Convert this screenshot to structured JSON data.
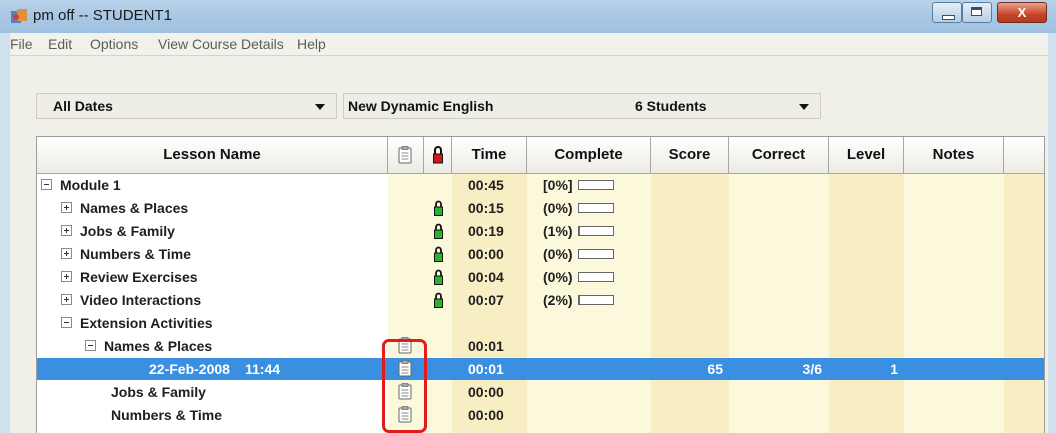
{
  "window": {
    "title": "pm off -- STUDENT1",
    "close_glyph": "X"
  },
  "menu": [
    "File",
    "Edit",
    "Options",
    "View Course Details",
    "Help"
  ],
  "filters": {
    "dates": "All Dates",
    "course": "New Dynamic English",
    "students": "6 Students"
  },
  "columns": {
    "lesson": "Lesson Name",
    "notes_icon": "clipboard-icon",
    "lock_icon": "lock-icon",
    "time": "Time",
    "complete": "Complete",
    "score": "Score",
    "correct": "Correct",
    "level": "Level",
    "notes": "Notes"
  },
  "colors": {
    "selection": "#3a8fe0",
    "lock_green": "#2bb32b",
    "lock_red": "#d01818",
    "highlight_box": "#e21b1b"
  },
  "rows": [
    {
      "lesson": "Module 1",
      "expander": "minus",
      "time": "00:45",
      "complete": "[0%]",
      "progress": 0
    },
    {
      "lesson": "Names & Places",
      "expander": "plus",
      "lock": "green",
      "time": "00:15",
      "complete": "(0%)",
      "progress": 0
    },
    {
      "lesson": "Jobs & Family",
      "expander": "plus",
      "lock": "green",
      "time": "00:19",
      "complete": "(1%)",
      "progress": 1
    },
    {
      "lesson": "Numbers & Time",
      "expander": "plus",
      "lock": "green",
      "time": "00:00",
      "complete": "(0%)",
      "progress": 0
    },
    {
      "lesson": "Review Exercises",
      "expander": "plus",
      "lock": "green",
      "time": "00:04",
      "complete": "(0%)",
      "progress": 0
    },
    {
      "lesson": "Video Interactions",
      "expander": "plus",
      "lock": "green",
      "time": "00:07",
      "complete": "(2%)",
      "progress": 2
    },
    {
      "lesson": "Extension Activities",
      "expander": "minus",
      "time": ""
    },
    {
      "lesson": "Names & Places",
      "expander": "minus",
      "clip": true,
      "time": "00:01"
    },
    {
      "lesson": "22-Feb-2008",
      "lesson_time": "11:44",
      "clip": true,
      "time": "00:01",
      "score": "65",
      "correct": "3/6",
      "level": "1",
      "selected": true
    },
    {
      "lesson": "Jobs & Family",
      "clip": true,
      "time": "00:00"
    },
    {
      "lesson": "Numbers & Time",
      "clip": true,
      "time": "00:00"
    }
  ]
}
